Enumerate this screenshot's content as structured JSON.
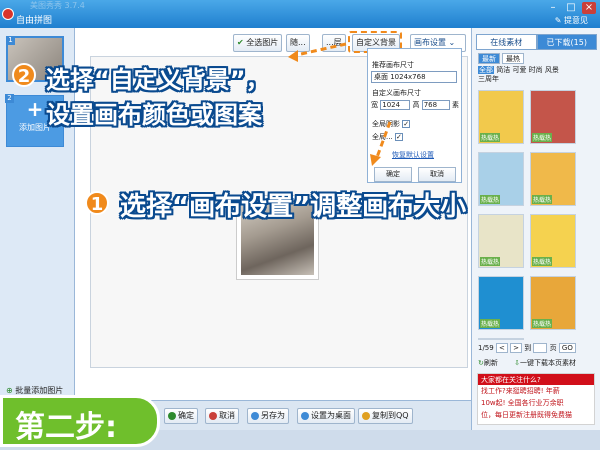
{
  "window": {
    "title": "自由拼图",
    "ghost_title": "美图秀秀 3.7.4",
    "feedback_label": "提意见",
    "min_label": "–",
    "max_label": "□",
    "close_label": "×"
  },
  "left_panel": {
    "thumbnails": [
      {
        "number": "1"
      },
      {
        "number": "2",
        "plus": "+",
        "label": "添加图片"
      }
    ],
    "batch_add_label": "批量添加图片"
  },
  "toolbar": {
    "select_all_label": "全选图片",
    "random_label": "随...",
    "layer_label": "...层",
    "custom_bg_label": "自定义背景",
    "canvas_settings_label": "画布设置"
  },
  "popup": {
    "recommended_size_label": "推荐画布尺寸",
    "recommended_value": "桌面 1024x768",
    "custom_size_label": "自定义画布尺寸",
    "width_label": "宽",
    "width_value": "1024",
    "height_label": "高",
    "height_value": "768",
    "unit_label": "素",
    "global_shadow_label": "全局阴影",
    "global_border_label": "全局...",
    "check_mark": "✓",
    "restore_default_label": "恢复默认设置",
    "ok_label": "确定",
    "cancel_label": "取消"
  },
  "annotations": {
    "step2_number": "2",
    "step2_line1": "选择“自定义背景”，",
    "step2_line2": "设置画布颜色或图案",
    "step1_number": "1",
    "step1_text": "选择“画布设置”调整画布大小",
    "step_badge": "第二步:",
    "accent": "#f08a1c",
    "outline": "#0a4a8f"
  },
  "right_panel": {
    "tabs": [
      {
        "label": "在线素材",
        "active": true
      },
      {
        "label": "已下载(15)",
        "active": false
      }
    ],
    "subtabs": [
      {
        "label": "最新",
        "active": true
      },
      {
        "label": "最热",
        "active": false
      }
    ],
    "categories_line1_on": "全部",
    "categories_line1": "简洁 可爱 时尚 风景",
    "categories_line2": "三周年",
    "template_tags": [
      "热载热",
      "热载热",
      "热载热",
      "热载热",
      "热载热",
      "热载热",
      "热载热",
      "热载热",
      "热载热",
      "热载热"
    ],
    "template_colors": [
      "#f2c94c",
      "#c4554a",
      "#a9d0e8",
      "#f0b94a",
      "#e8e4c8",
      "#f5d24f",
      "#1f8fd1",
      "#e8a73a",
      "#ece6d6",
      "#f2c16a"
    ],
    "pager": {
      "page": "1/59",
      "prev": "<",
      "next": ">",
      "goto_label": "到",
      "page_unit": "页",
      "go_label": "GO"
    },
    "refresh_label": "刷新",
    "download_all_label": "一键下载本页素材",
    "ad": {
      "head": "大家都在关注什么?",
      "line1": "找工作?来挺聘招聘! 年薪",
      "line2": "10w起! 全国各行业万余职",
      "line3": "位，每日更新注册既得免费猫"
    }
  },
  "bottom_bar": {
    "ok_label": "确定",
    "cancel_label": "取消",
    "save_as_label": "另存为",
    "set_desktop_label": "设置为桌面",
    "copy_qq_label": "复制到QQ"
  }
}
